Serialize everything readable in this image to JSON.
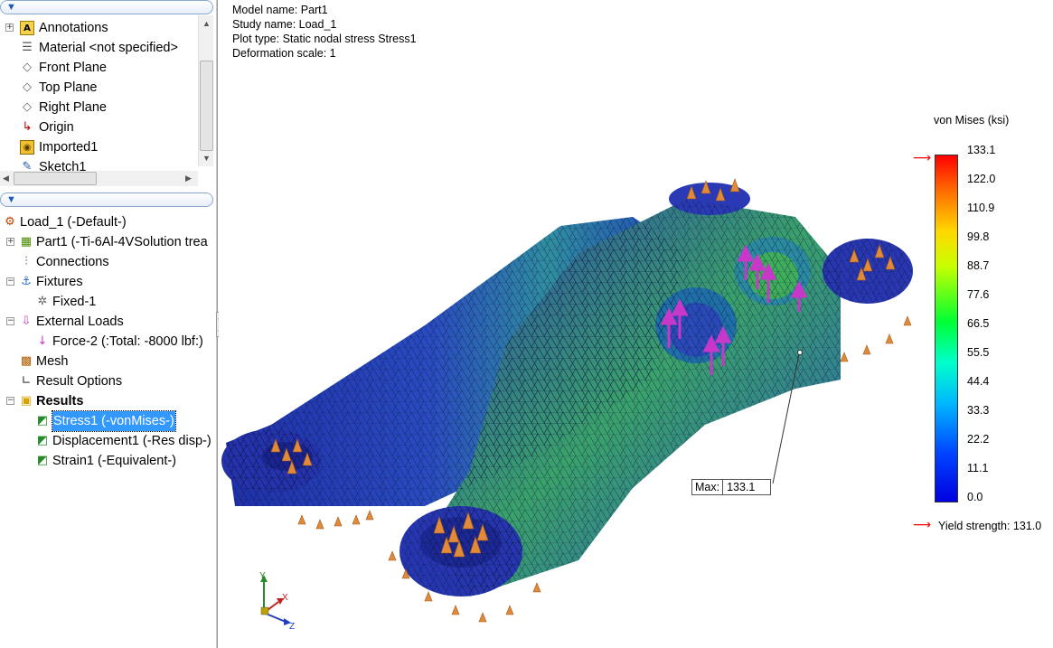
{
  "feature_tree": {
    "items": [
      {
        "label": "Annotations",
        "icon": "annotations-icon"
      },
      {
        "label": "Material <not specified>",
        "icon": "material-icon"
      },
      {
        "label": "Front Plane",
        "icon": "plane-icon"
      },
      {
        "label": "Top Plane",
        "icon": "plane-icon"
      },
      {
        "label": "Right Plane",
        "icon": "plane-icon"
      },
      {
        "label": "Origin",
        "icon": "origin-icon"
      },
      {
        "label": "Imported1",
        "icon": "imported-body-icon"
      },
      {
        "label": "Sketch1",
        "icon": "sketch-icon"
      }
    ]
  },
  "study_tree": {
    "items": [
      {
        "label": "Load_1 (-Default-)"
      },
      {
        "label": "Part1 (-Ti-6Al-4VSolution trea"
      },
      {
        "label": "Connections"
      },
      {
        "label": "Fixtures"
      },
      {
        "label": "Fixed-1"
      },
      {
        "label": "External Loads"
      },
      {
        "label": "Force-2 (:Total: -8000 lbf:)"
      },
      {
        "label": "Mesh"
      },
      {
        "label": "Result Options"
      },
      {
        "label": "Results"
      },
      {
        "label": "Stress1 (-vonMises-)"
      },
      {
        "label": "Displacement1 (-Res disp-)"
      },
      {
        "label": "Strain1 (-Equivalent-)"
      }
    ]
  },
  "plot_info": {
    "model_name": "Model name: Part1",
    "study_name": "Study name: Load_1",
    "plot_type": "Plot type: Static nodal stress Stress1",
    "deformation_scale": "Deformation scale: 1"
  },
  "legend": {
    "title": "von Mises (ksi)",
    "ticks": [
      "133.1",
      "122.0",
      "110.9",
      "99.8",
      "88.7",
      "77.6",
      "66.5",
      "55.5",
      "44.4",
      "33.3",
      "22.2",
      "11.1",
      "0.0"
    ],
    "yield_label": "Yield strength: 131.0",
    "yield_value": 131.0,
    "max_value": 133.1,
    "min_value": 0.0,
    "marker_color": "#ff0000"
  },
  "probe": {
    "key": "Max:",
    "value": "133.1"
  },
  "triad": {
    "x": "X",
    "y": "Y",
    "z": "Z"
  },
  "colors": {
    "selection": "#3399ff",
    "mesh_low": "#1a2a9c",
    "mesh_high": "#3fb04a",
    "fixture": "#e08a3a",
    "load_arrow": "#c838c8"
  }
}
